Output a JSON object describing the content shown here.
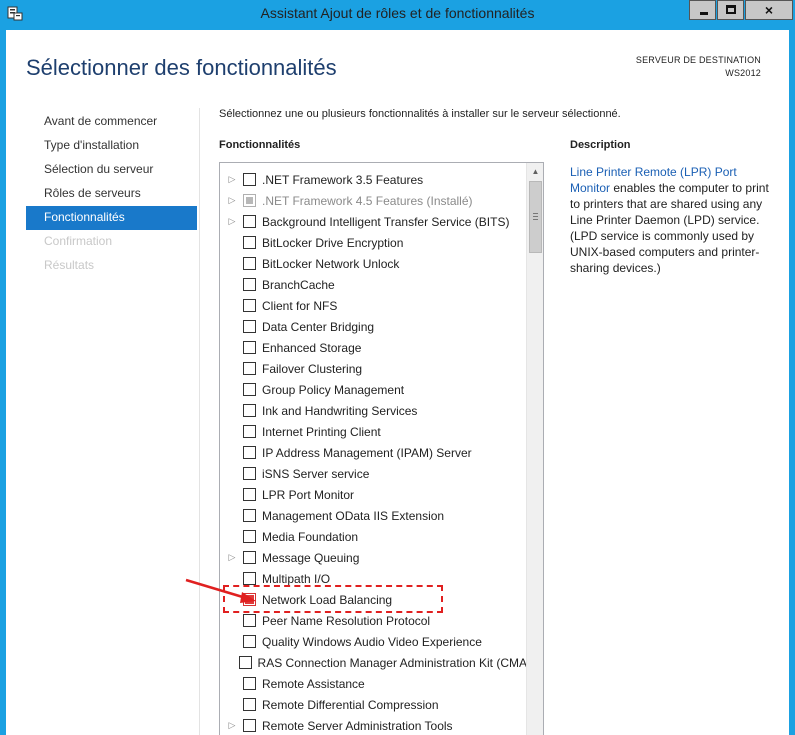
{
  "window": {
    "title": "Assistant Ajout de rôles et de fonctionnalités",
    "close_glyph": "×"
  },
  "header": {
    "page_title": "Sélectionner des fonctionnalités",
    "destination_label": "SERVEUR DE DESTINATION",
    "destination_server": "WS2012"
  },
  "nav": {
    "items": [
      {
        "label": "Avant de commencer",
        "state": "normal"
      },
      {
        "label": "Type d'installation",
        "state": "normal"
      },
      {
        "label": "Sélection du serveur",
        "state": "normal"
      },
      {
        "label": "Rôles de serveurs",
        "state": "normal"
      },
      {
        "label": "Fonctionnalités",
        "state": "active"
      },
      {
        "label": "Confirmation",
        "state": "disabled"
      },
      {
        "label": "Résultats",
        "state": "disabled"
      }
    ]
  },
  "main": {
    "intro": "Sélectionnez une ou plusieurs fonctionnalités à installer sur le serveur sélectionné.",
    "features_header": "Fonctionnalités",
    "description_header": "Description",
    "description_link": "Line Printer Remote (LPR) Port Monitor",
    "description_body": " enables the computer to print to printers that are shared using any Line Printer Daemon (LPD) service. (LPD service is commonly used by UNIX-based computers and printer-sharing devices.)"
  },
  "features": [
    {
      "label": ".NET Framework 3.5 Features",
      "expandable": true,
      "state": "unchecked"
    },
    {
      "label": ".NET Framework 4.5 Features (Installé)",
      "expandable": true,
      "state": "installed"
    },
    {
      "label": "Background Intelligent Transfer Service (BITS)",
      "expandable": true,
      "state": "unchecked"
    },
    {
      "label": "BitLocker Drive Encryption",
      "expandable": false,
      "state": "unchecked"
    },
    {
      "label": "BitLocker Network Unlock",
      "expandable": false,
      "state": "unchecked"
    },
    {
      "label": "BranchCache",
      "expandable": false,
      "state": "unchecked"
    },
    {
      "label": "Client for NFS",
      "expandable": false,
      "state": "unchecked"
    },
    {
      "label": "Data Center Bridging",
      "expandable": false,
      "state": "unchecked"
    },
    {
      "label": "Enhanced Storage",
      "expandable": false,
      "state": "unchecked"
    },
    {
      "label": "Failover Clustering",
      "expandable": false,
      "state": "unchecked"
    },
    {
      "label": "Group Policy Management",
      "expandable": false,
      "state": "unchecked"
    },
    {
      "label": "Ink and Handwriting Services",
      "expandable": false,
      "state": "unchecked"
    },
    {
      "label": "Internet Printing Client",
      "expandable": false,
      "state": "unchecked"
    },
    {
      "label": "IP Address Management (IPAM) Server",
      "expandable": false,
      "state": "unchecked"
    },
    {
      "label": "iSNS Server service",
      "expandable": false,
      "state": "unchecked"
    },
    {
      "label": "LPR Port Monitor",
      "expandable": false,
      "state": "unchecked"
    },
    {
      "label": "Management OData IIS Extension",
      "expandable": false,
      "state": "unchecked"
    },
    {
      "label": "Media Foundation",
      "expandable": false,
      "state": "unchecked"
    },
    {
      "label": "Message Queuing",
      "expandable": true,
      "state": "unchecked"
    },
    {
      "label": "Multipath I/O",
      "expandable": false,
      "state": "unchecked"
    },
    {
      "label": "Network Load Balancing",
      "expandable": false,
      "state": "highlighted"
    },
    {
      "label": "Peer Name Resolution Protocol",
      "expandable": false,
      "state": "unchecked"
    },
    {
      "label": "Quality Windows Audio Video Experience",
      "expandable": false,
      "state": "unchecked"
    },
    {
      "label": "RAS Connection Manager Administration Kit (CMA",
      "expandable": false,
      "state": "unchecked"
    },
    {
      "label": "Remote Assistance",
      "expandable": false,
      "state": "unchecked"
    },
    {
      "label": "Remote Differential Compression",
      "expandable": false,
      "state": "unchecked"
    },
    {
      "label": "Remote Server Administration Tools",
      "expandable": true,
      "state": "unchecked"
    }
  ],
  "icons": {
    "expander": "▷",
    "scroll_up": "▲"
  },
  "colors": {
    "titlebar": "#1ba1e2",
    "nav_active": "#1979ca",
    "page_title": "#1e3f6e",
    "link": "#1a5fb4",
    "annotation": "#e02020"
  }
}
